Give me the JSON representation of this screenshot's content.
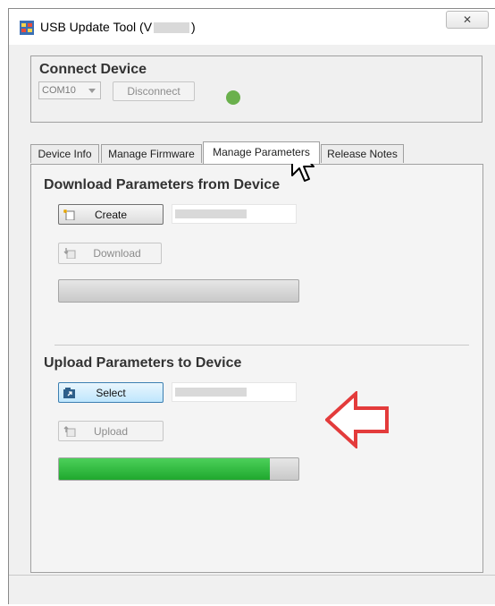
{
  "window": {
    "title_prefix": "USB Update Tool  (V",
    "title_suffix": ")",
    "close_glyph": "✕"
  },
  "connect": {
    "title": "Connect Device",
    "port_value": "COM10",
    "disconnect_label": "Disconnect",
    "status_color": "#6ab04c"
  },
  "tabs": [
    {
      "label": "Device Info"
    },
    {
      "label": "Manage Firmware"
    },
    {
      "label": "Manage Parameters"
    },
    {
      "label": "Release Notes"
    }
  ],
  "download": {
    "title": "Download Parameters from Device",
    "create_label": "Create",
    "download_label": "Download",
    "progress_percent": 0
  },
  "upload": {
    "title": "Upload Parameters to Device",
    "select_label": "Select",
    "upload_label": "Upload",
    "progress_percent": 88
  },
  "colors": {
    "annotation_arrow": "#e33b3b",
    "progress_fill": "#2dbf3d"
  },
  "icons": {
    "app": "app-window-icon",
    "create": "new-file-icon",
    "download": "download-icon",
    "select": "open-folder-icon",
    "upload": "upload-icon"
  }
}
